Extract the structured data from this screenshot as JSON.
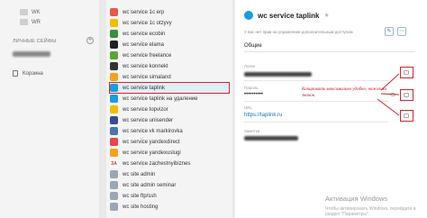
{
  "sidebar": {
    "folders": [
      {
        "label": "WK"
      },
      {
        "label": "WR"
      }
    ],
    "section_title": "ЛИЧНЫЕ СЕЙФЫ",
    "add_symbol": "+",
    "trash_label": "Корзина"
  },
  "list": {
    "items": [
      {
        "label": "wc service 1c erp",
        "color": "#e8574a",
        "glyph": ""
      },
      {
        "label": "wc service 1c otzyvy",
        "color": "#f0c000",
        "glyph": ""
      },
      {
        "label": "wc service ecobin",
        "color": "#3a8f3a",
        "glyph": ""
      },
      {
        "label": "wc service elama",
        "color": "#222222",
        "glyph": ""
      },
      {
        "label": "wc service freelance",
        "color": "#5aa63a",
        "glyph": ""
      },
      {
        "label": "wc service konnekt",
        "color": "#333333",
        "glyph": ""
      },
      {
        "label": "wc service simaland",
        "color": "#f5a21b",
        "glyph": ""
      },
      {
        "label": "wc service taplink",
        "color": "#1b9ce0",
        "glyph": "",
        "active": true
      },
      {
        "label": "wc service taplink на удаление",
        "color": "#1b9ce0",
        "glyph": ""
      },
      {
        "label": "wc service topvizor",
        "color": "#f0c000",
        "glyph": ""
      },
      {
        "label": "wc service unisender",
        "color": "#3a4a8f",
        "glyph": ""
      },
      {
        "label": "wc service vk markirovka",
        "color": "#4a76a8",
        "glyph": ""
      },
      {
        "label": "wc service yandexdirect",
        "color": "#e8474a",
        "glyph": ""
      },
      {
        "label": "wc service yandexuslugi",
        "color": "#f5a21b",
        "glyph": ""
      },
      {
        "label": "wc service zachestnyibiznes",
        "color": "#c0392b",
        "glyph": "ЗА"
      },
      {
        "label": "wc site admin",
        "color": "#9aa7b5",
        "glyph": ""
      },
      {
        "label": "wc site admin seminar",
        "color": "#9aa7b5",
        "glyph": ""
      },
      {
        "label": "wc site ftp/ssh",
        "color": "#9aa7b5",
        "glyph": ""
      },
      {
        "label": "wc site hosting",
        "color": "#9aa7b5",
        "glyph": ""
      }
    ]
  },
  "panel": {
    "title": "wc service taplink",
    "star": "★",
    "note": "У вас нет прав на управление дополнительным доступом",
    "edit_btn": "✎",
    "more_btn": "⋯",
    "tab": "Общие",
    "login_label": "Логин",
    "password_label": "Пароль",
    "password_value": "••••••••••",
    "url_label": "URL",
    "url_value": "https://taplink.ru",
    "notes_label": "Заметки",
    "annotation": "Копировать максимально удобно, нажав на значок."
  },
  "watermark": {
    "title": "Активация Windows",
    "subtitle": "Чтобы активировать Windows, перейдите в раздел \"Параметры\"."
  },
  "colors": {
    "highlight": "#d6242b",
    "accent": "#1b9ce0"
  }
}
